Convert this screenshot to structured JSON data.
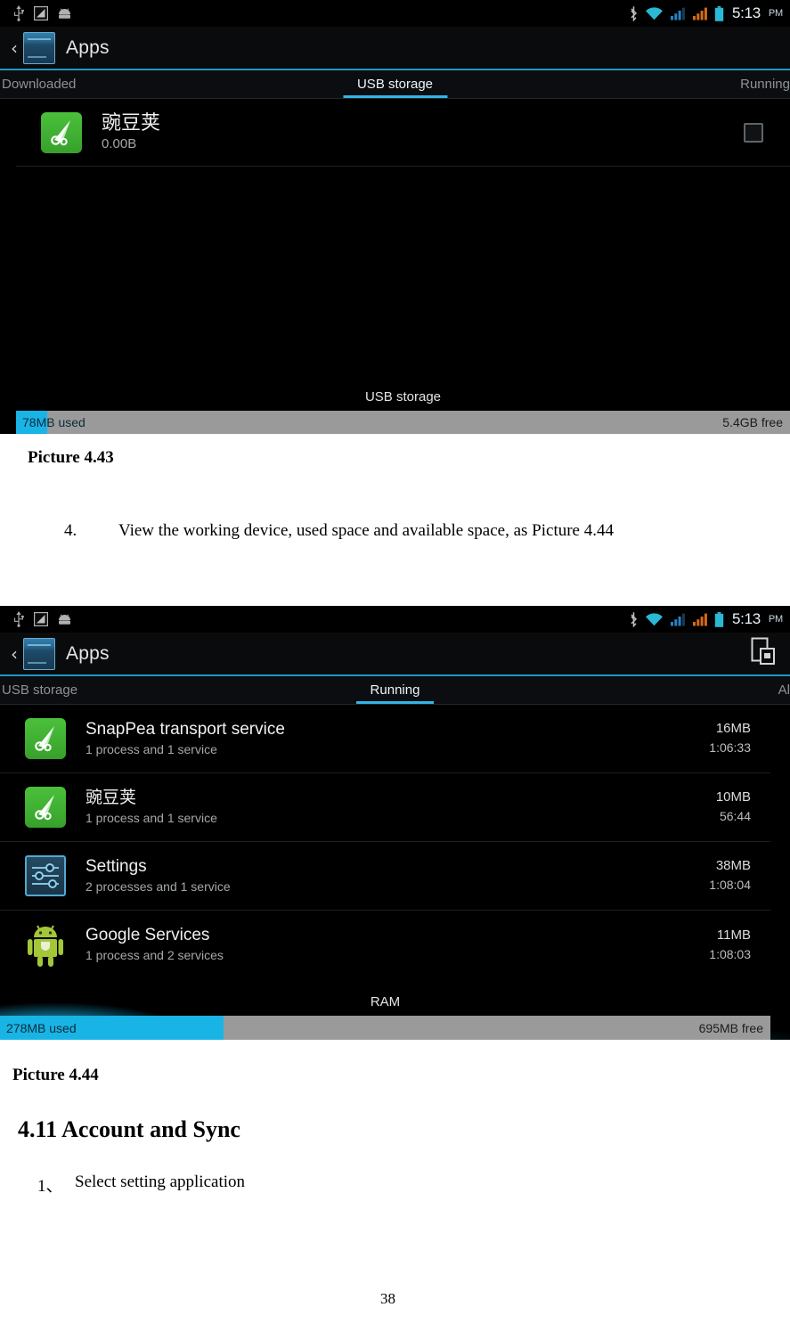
{
  "page": {
    "number": "38"
  },
  "figure1": {
    "caption": "Picture 4.43",
    "statusbar": {
      "icons": [
        "usb-icon",
        "screenshot-icon",
        "android-icon"
      ],
      "right_icons": [
        "bluetooth-icon",
        "wifi-icon",
        "signal-icon-1",
        "signal-icon-2",
        "battery-icon"
      ],
      "time": "5:13",
      "ampm": "PM"
    },
    "actionbar": {
      "back": "‹",
      "app_icon": "settings-app-icon",
      "title": "Apps"
    },
    "tabs": [
      {
        "label": "Downloaded",
        "active": false
      },
      {
        "label": "USB storage",
        "active": true
      },
      {
        "label": "Running",
        "active": false
      }
    ],
    "rows": [
      {
        "icon": "snappea-icon",
        "title": "豌豆荚",
        "sub": "0.00B",
        "checkbox": "unchecked"
      }
    ],
    "meter": {
      "label": "USB storage",
      "used_text": "78MB used",
      "free_text": "5.4GB free",
      "used_percent": 4,
      "used_color": "#19b4e6",
      "free_color": "#9a9a9a"
    }
  },
  "step4": {
    "number": "4.",
    "text": "View the working device, used space and available space, as Picture 4.44"
  },
  "figure2": {
    "caption": "Picture 4.44",
    "statusbar": {
      "icons": [
        "usb-icon",
        "screenshot-icon",
        "android-icon"
      ],
      "right_icons": [
        "bluetooth-icon",
        "wifi-icon",
        "signal-icon-1",
        "signal-icon-2",
        "battery-icon"
      ],
      "time": "5:13",
      "ampm": "PM"
    },
    "actionbar": {
      "back": "‹",
      "app_icon": "settings-app-icon",
      "title": "Apps",
      "action_icon": "show-cached-processes-icon"
    },
    "tabs": [
      {
        "label": "USB storage",
        "active": false
      },
      {
        "label": "Running",
        "active": true
      },
      {
        "label": "Al",
        "active": false
      }
    ],
    "rows": [
      {
        "icon": "snappea-icon",
        "title": "SnapPea transport service",
        "sub": "1 process and 1 service",
        "mem": "16MB",
        "time": "1:06:33"
      },
      {
        "icon": "snappea-icon",
        "title": "豌豆荚",
        "sub": "1 process and 1 service",
        "mem": "10MB",
        "time": "56:44"
      },
      {
        "icon": "settings-icon",
        "title": "Settings",
        "sub": "2 processes and 1 service",
        "mem": "38MB",
        "time": "1:08:04"
      },
      {
        "icon": "android-icon",
        "title": "Google Services",
        "sub": "1 process and 2 services",
        "mem": "11MB",
        "time": "1:08:03"
      }
    ],
    "meter": {
      "label": "RAM",
      "used_text": "278MB used",
      "free_text": "695MB free",
      "used_percent": 29,
      "used_color": "#19b4e6",
      "free_color": "#9a9a9a"
    }
  },
  "section": {
    "heading": "4.11 Account and Sync",
    "item1_number": "1、",
    "item1_text": "Select setting application"
  }
}
